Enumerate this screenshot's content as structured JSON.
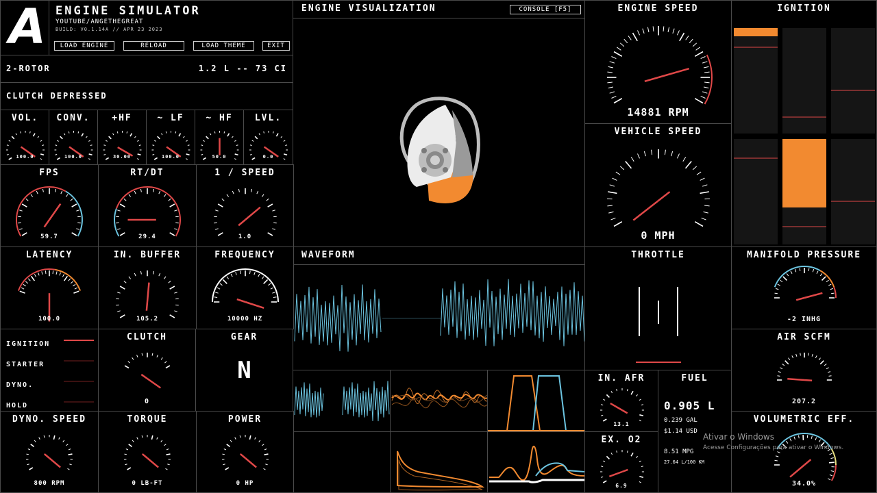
{
  "header": {
    "logo": "A",
    "title": "ENGINE SIMULATOR",
    "subtitle": "YOUTUBE/ANGETHEGREAT",
    "build": "BUILD: V0.1.14A // APR 23 2023",
    "buttons": [
      "LOAD ENGINE",
      "RELOAD",
      "LOAD THEME",
      "EXIT"
    ]
  },
  "engine_info": {
    "name": "2-ROTOR",
    "displacement": "1.2 L -- 73 CI"
  },
  "clutch_status": "CLUTCH DEPRESSED",
  "audio": [
    {
      "label": "VOL.",
      "value": "100.0",
      "level": 1.0
    },
    {
      "label": "CONV.",
      "value": "100.0",
      "level": 1.0
    },
    {
      "label": "+HF",
      "value": "30.00",
      "level": 0.9
    },
    {
      "label": "~ LF",
      "value": "100.0",
      "level": 1.0
    },
    {
      "label": "~ HF",
      "value": "50.0",
      "level": 0.5
    },
    {
      "label": "LVL.",
      "value": "0.0",
      "level": 1.0
    }
  ],
  "perf": [
    {
      "label": "FPS",
      "value": "59.7"
    },
    {
      "label": "RT/DT",
      "value": "29.4"
    },
    {
      "label": "1 / SPEED",
      "value": "1.0"
    }
  ],
  "perf2": [
    {
      "label": "LATENCY",
      "value": "100.0"
    },
    {
      "label": "IN. BUFFER",
      "value": "105.2"
    },
    {
      "label": "FREQUENCY",
      "value": "10000 HZ"
    }
  ],
  "toggles": [
    "IGNITION",
    "STARTER",
    "DYNO.",
    "HOLD"
  ],
  "clutch": {
    "label": "CLUTCH",
    "value": "0"
  },
  "gear": {
    "label": "GEAR",
    "value": "N"
  },
  "dyno": [
    {
      "label": "DYNO. SPEED",
      "value": "800 RPM"
    },
    {
      "label": "TORQUE",
      "value": "0 LB-FT"
    },
    {
      "label": "POWER",
      "value": "0 HP"
    }
  ],
  "viz": {
    "title": "ENGINE VISUALIZATION",
    "console": "CONSOLE [F5]"
  },
  "waveform": {
    "title": "WAVEFORM"
  },
  "engine_speed": {
    "title": "ENGINE SPEED",
    "value": "14881 RPM",
    "level": 0.95
  },
  "vehicle_speed": {
    "title": "VEHICLE SPEED",
    "value": "0 MPH"
  },
  "ignition": {
    "title": "IGNITION"
  },
  "throttle": {
    "title": "THROTTLE"
  },
  "manifold": {
    "title": "MANIFOLD PRESSURE",
    "value": "-2 INHG"
  },
  "air": {
    "title": "AIR SCFM",
    "value": "207.2"
  },
  "in_afr": {
    "title": "IN. AFR",
    "value": "13.1"
  },
  "ex_o2": {
    "title": "EX. O2",
    "value": "6.9"
  },
  "fuel": {
    "title": "FUEL",
    "liters": "0.905 L",
    "gal": "0.239 GAL",
    "usd": "$1.14 USD",
    "mpg": "8.51 MPG",
    "l100": "27.64 L/100 KM"
  },
  "ve": {
    "title": "VOLUMETRIC EFF.",
    "value": "34.0%"
  },
  "watermark": {
    "line1": "Ativar o Windows",
    "line2": "Acesse Configurações para ativar o Windows."
  },
  "colors": {
    "accent": "#f28a30",
    "red": "#e04848",
    "blue": "#6cc4e0",
    "border": "#4a4a4a"
  }
}
